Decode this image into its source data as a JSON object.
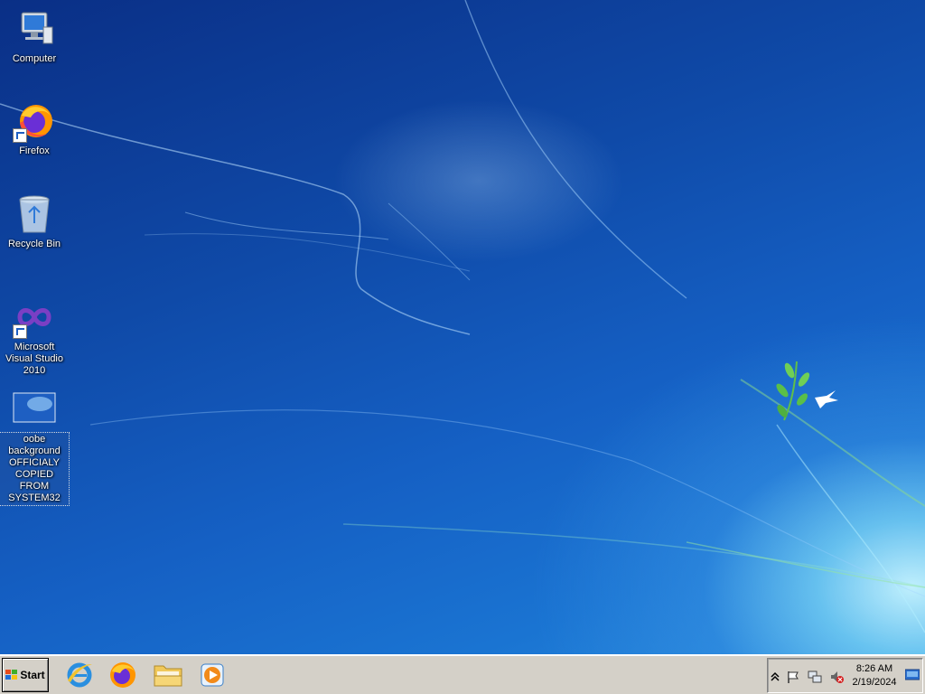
{
  "desktop": {
    "icons": [
      {
        "label": "Computer",
        "icon": "computer-icon"
      },
      {
        "label": "Firefox",
        "icon": "firefox-icon"
      },
      {
        "label": "Recycle Bin",
        "icon": "recycle-bin-icon"
      },
      {
        "label": "Microsoft Visual Studio 2010",
        "icon": "visual-studio-icon"
      },
      {
        "label": "oobe background OFFICIALY COPIED FROM SYSTEM32",
        "icon": "image-file-icon"
      }
    ]
  },
  "taskbar": {
    "start_label": "Start",
    "pinned": [
      {
        "name": "Internet Explorer",
        "icon": "ie-icon"
      },
      {
        "name": "Firefox",
        "icon": "firefox-icon"
      },
      {
        "name": "Windows Explorer",
        "icon": "folder-icon"
      },
      {
        "name": "Windows Media Player",
        "icon": "media-player-icon"
      }
    ],
    "tray": {
      "time": "8:26 AM",
      "date": "2/19/2024",
      "icons": [
        "show-hidden-icons-chevron",
        "action-center-flag-icon",
        "network-icon",
        "volume-muted-icon",
        "show-desktop-icon"
      ]
    }
  },
  "colors": {
    "taskbar": "#d4d0c8",
    "desktop_blue": "#0f4aa8",
    "desktop_glow": "#aaf0ff"
  }
}
